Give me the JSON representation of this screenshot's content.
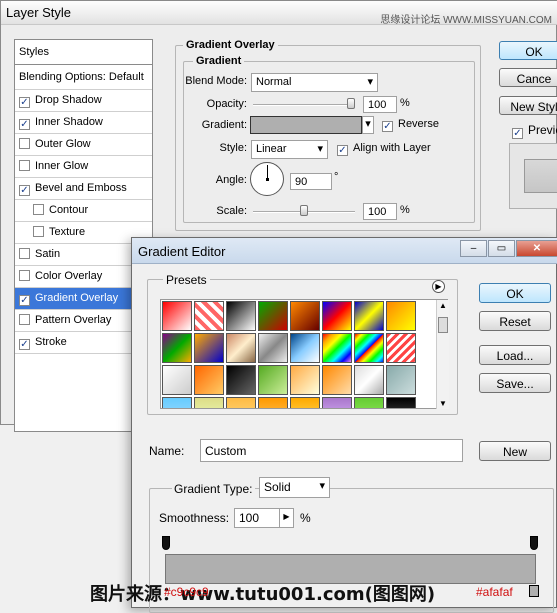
{
  "window": {
    "title": "Layer Style",
    "watermark": "思缘设计论坛 WWW.MISSYUAN.COM"
  },
  "styles": {
    "header": "Styles",
    "blending": "Blending Options: Default",
    "items": [
      {
        "label": "Drop Shadow",
        "checked": true
      },
      {
        "label": "Inner Shadow",
        "checked": true
      },
      {
        "label": "Outer Glow",
        "checked": false
      },
      {
        "label": "Inner Glow",
        "checked": false
      },
      {
        "label": "Bevel and Emboss",
        "checked": true
      },
      {
        "label": "Contour",
        "checked": false
      },
      {
        "label": "Texture",
        "checked": false
      },
      {
        "label": "Satin",
        "checked": false
      },
      {
        "label": "Color Overlay",
        "checked": false
      },
      {
        "label": "Gradient Overlay",
        "checked": true
      },
      {
        "label": "Pattern Overlay",
        "checked": false
      },
      {
        "label": "Stroke",
        "checked": true
      }
    ]
  },
  "overlay": {
    "group_title": "Gradient Overlay",
    "sub_title": "Gradient",
    "blend_label": "Blend Mode:",
    "blend_value": "Normal",
    "opacity_label": "Opacity:",
    "opacity_value": "100",
    "opacity_unit": "%",
    "opacity_level": 1.0,
    "gradient_label": "Gradient:",
    "reverse_label": "Reverse",
    "reverse_checked": true,
    "style_label": "Style:",
    "style_value": "Linear",
    "align_label": "Align with Layer",
    "align_checked": true,
    "angle_label": "Angle:",
    "angle_value": "90",
    "angle_unit": "°",
    "scale_label": "Scale:",
    "scale_value": "100",
    "scale_unit": "%",
    "scale_level": 0.5
  },
  "right_buttons": {
    "ok": "OK",
    "cancel": "Cance",
    "new_style": "New Styl",
    "preview_label": "Previe",
    "preview_checked": true
  },
  "editor": {
    "title": "Gradient Editor",
    "presets_label": "Presets",
    "ok": "OK",
    "reset": "Reset",
    "load": "Load...",
    "save": "Save...",
    "name_label": "Name:",
    "name_value": "Custom",
    "new_label": "New",
    "type_label": "Gradient Type:",
    "type_value": "Solid",
    "smooth_label": "Smoothness:",
    "smooth_value": "100",
    "smooth_unit": "%",
    "ramp_color": "#afafaf"
  },
  "credit": "图片来源：www.tutu001.com(图图网)",
  "color_tags": {
    "left": "#c9c9c9",
    "right": "#afafaf"
  },
  "window_buttons": {
    "minimize": "–",
    "maximize": "▭",
    "close": "✕"
  }
}
